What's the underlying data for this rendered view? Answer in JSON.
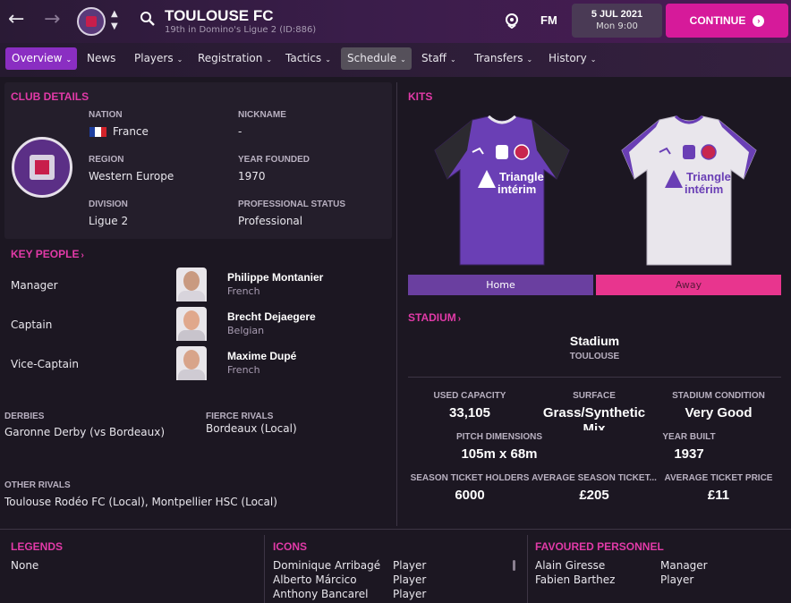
{
  "header": {
    "team_name": "TOULOUSE FC",
    "team_sub": "19th in Domino's Ligue 2 (ID:886)",
    "fm_label": "FM",
    "date": "5 JUL 2021",
    "time": "Mon 9:00",
    "continue_label": "CONTINUE"
  },
  "nav": {
    "tabs": [
      {
        "label": "Overview",
        "has_menu": true
      },
      {
        "label": "News",
        "has_menu": false
      },
      {
        "label": "Players",
        "has_menu": true
      },
      {
        "label": "Registration",
        "has_menu": true
      },
      {
        "label": "Tactics",
        "has_menu": true
      },
      {
        "label": "Schedule",
        "has_menu": true
      },
      {
        "label": "Staff",
        "has_menu": true
      },
      {
        "label": "Transfers",
        "has_menu": true
      },
      {
        "label": "History",
        "has_menu": true
      }
    ],
    "active_tab": "Overview",
    "hovered_tab": "Schedule"
  },
  "club_details": {
    "title": "CLUB DETAILS",
    "nation_label": "NATION",
    "nation": "France",
    "nickname_label": "NICKNAME",
    "nickname": "-",
    "region_label": "REGION",
    "region": "Western Europe",
    "founded_label": "YEAR FOUNDED",
    "founded": "1970",
    "division_label": "DIVISION",
    "division": "Ligue 2",
    "status_label": "PROFESSIONAL STATUS",
    "status": "Professional"
  },
  "key_people": {
    "title": "KEY PEOPLE",
    "people": [
      {
        "role": "Manager",
        "name": "Philippe Montanier",
        "nationality": "French"
      },
      {
        "role": "Captain",
        "name": "Brecht Dejaegere",
        "nationality": "Belgian"
      },
      {
        "role": "Vice-Captain",
        "name": "Maxime Dupé",
        "nationality": "French"
      }
    ]
  },
  "rivals": {
    "derbies_label": "DERBIES",
    "derbies": "Garonne Derby (vs Bordeaux)",
    "fierce_label": "FIERCE RIVALS",
    "fierce": "Bordeaux (Local)",
    "other_label": "OTHER RIVALS",
    "other": "Toulouse Rodéo FC (Local), Montpellier HSC (Local)"
  },
  "kits": {
    "title": "KITS",
    "home_label": "Home",
    "away_label": "Away",
    "sponsor_line1": "Triangle",
    "sponsor_line2": "intérim",
    "home_color": "#6a3fb5",
    "away_color": "#e9e6ec"
  },
  "stadium": {
    "title": "STADIUM",
    "name": "Stadium",
    "city": "TOULOUSE",
    "stats": [
      {
        "label": "USED CAPACITY",
        "value": "33,105"
      },
      {
        "label": "SURFACE",
        "value": "Grass/Synthetic Mix"
      },
      {
        "label": "STADIUM CONDITION",
        "value": "Very Good"
      },
      {
        "label": "PITCH DIMENSIONS",
        "value": "105m x 68m"
      },
      {
        "label": "YEAR BUILT",
        "value": "1937"
      },
      {
        "label": "SEASON TICKET HOLDERS",
        "value": "6000"
      },
      {
        "label": "AVERAGE SEASON TICKET...",
        "value": "£205"
      },
      {
        "label": "AVERAGE TICKET PRICE",
        "value": "£11"
      }
    ]
  },
  "legends": {
    "title": "LEGENDS",
    "value": "None"
  },
  "icons": {
    "title": "ICONS",
    "rows": [
      {
        "name": "Dominique Arribagé",
        "role": "Player"
      },
      {
        "name": "Alberto Márcico",
        "role": "Player"
      },
      {
        "name": "Anthony Bancarel",
        "role": "Player"
      }
    ]
  },
  "favoured": {
    "title": "FAVOURED PERSONNEL",
    "rows": [
      {
        "name": "Alain Giresse",
        "role": "Manager"
      },
      {
        "name": "Fabien Barthez",
        "role": "Player"
      }
    ]
  },
  "colors": {
    "accent": "#e23aa8",
    "continue": "#d61a9a",
    "active_tab": "#8a2ec2"
  }
}
